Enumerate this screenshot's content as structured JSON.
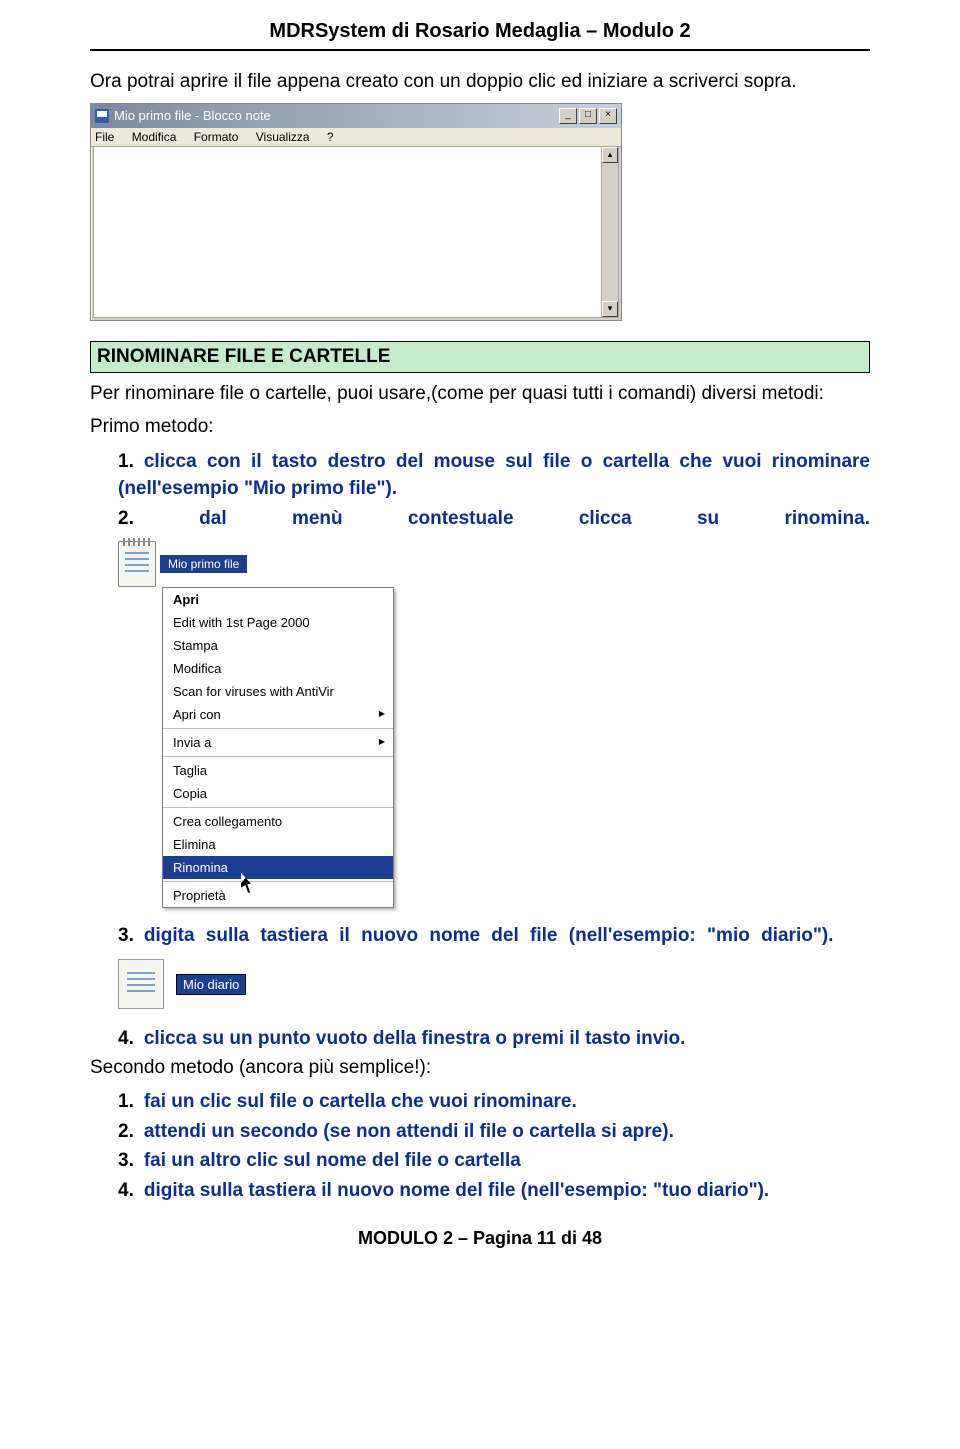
{
  "header": {
    "title": "MDRSystem di Rosario Medaglia – Modulo 2"
  },
  "intro": "Ora potrai aprire il file appena creato con un doppio clic ed iniziare a scriverci sopra.",
  "notepad": {
    "title": "Mio primo file - Blocco note",
    "menu": [
      "File",
      "Modifica",
      "Formato",
      "Visualizza",
      "?"
    ],
    "minimize": "_",
    "maximize": "□",
    "close": "×",
    "scroll_up": "▴",
    "scroll_down": "▾"
  },
  "section": {
    "title": "RINOMINARE FILE E CARTELLE"
  },
  "para1": "Per rinominare file o cartelle, puoi usare,(come per quasi tutti i comandi) diversi metodi:",
  "primo": "Primo metodo:",
  "step1": {
    "num": "1.",
    "text": "clicca con il tasto destro del mouse sul file o cartella che vuoi rinominare (nell'esempio \"Mio primo file\")."
  },
  "step2": {
    "num": "2.",
    "w1": "dal",
    "w2": "menù",
    "w3": "contestuale",
    "w4": "clicca",
    "w5": "su",
    "w6": "rinomina."
  },
  "ctx": {
    "file_label": "Mio primo file",
    "items": {
      "apri": "Apri",
      "edit1st": "Edit with 1st Page 2000",
      "stampa": "Stampa",
      "modifica": "Modifica",
      "scan": "Scan for viruses with AntiVir",
      "apricon": "Apri con",
      "inviaa": "Invia a",
      "taglia": "Taglia",
      "copia": "Copia",
      "crea": "Crea collegamento",
      "elimina": "Elimina",
      "rinomina": "Rinomina",
      "proprieta": "Proprietà"
    }
  },
  "step3": {
    "num": "3.",
    "text": "digita sulla tastiera il nuovo nome del file (nell'esempio: \"mio diario\")."
  },
  "rename_label": "Mio diario",
  "step4": {
    "num": "4.",
    "text": "clicca su un punto vuoto della finestra o premi il tasto invio."
  },
  "secondo": "Secondo metodo (ancora più semplice!):",
  "m2": {
    "s1": {
      "num": "1.",
      "text": "fai un clic sul file o cartella che vuoi rinominare."
    },
    "s2": {
      "num": "2.",
      "text": "attendi un secondo (se non attendi il file o cartella si apre)."
    },
    "s3": {
      "num": "3.",
      "text": "fai un altro clic sul nome del file o cartella"
    },
    "s4": {
      "num": "4.",
      "text": "digita sulla tastiera il nuovo nome del file (nell'esempio: \"tuo diario\")."
    }
  },
  "footer": "MODULO 2 – Pagina 11 di 48"
}
